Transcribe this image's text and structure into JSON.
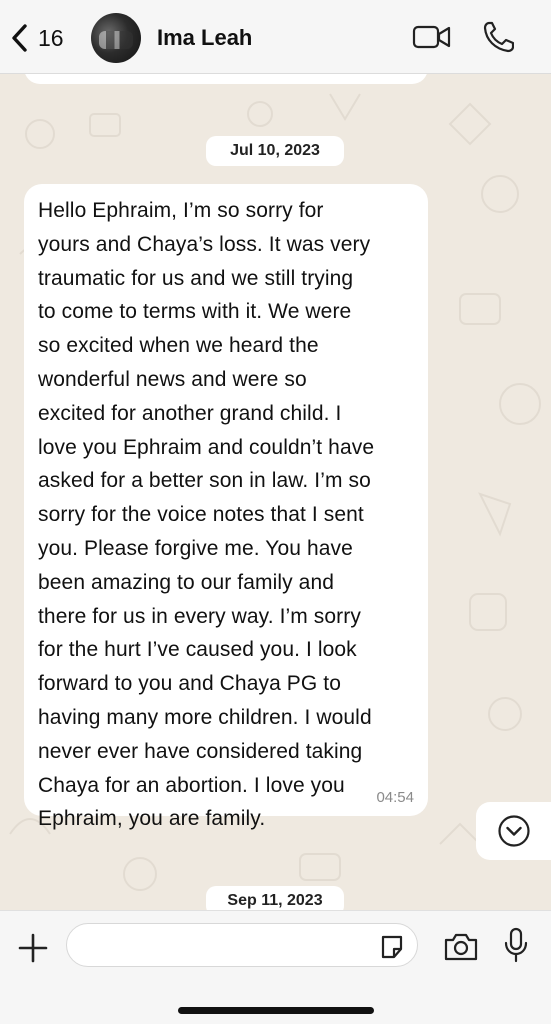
{
  "header": {
    "back_count": "16",
    "contact_name": "Ima Leah"
  },
  "chat": {
    "date_separator_1": "Jul 10, 2023",
    "message": {
      "text": "Hello Ephraim, I’m so sorry for\nyours and Chaya’s loss. It was very\ntraumatic for us and we still trying\nto come to terms with it. We were\nso excited when we heard the\nwonderful news and were so\nexcited for another grand child. I\nlove you Ephraim and couldn’t have\nasked for a better son in law. I’m so\nsorry for the voice notes that I sent\nyou. Please forgive me. You have\nbeen amazing to our family and\nthere for us in every way. I’m sorry\nfor the hurt I’ve caused you. I look\nforward to you and Chaya PG to\nhaving many more children. I would\nnever ever have considered taking\nChaya for an abortion. I love you\nEphraim, you are family.",
      "time": "04:54"
    },
    "date_separator_2": "Sep 11, 2023"
  },
  "input_bar": {
    "value": "",
    "placeholder": ""
  },
  "icons": {
    "back": "chevron-left-icon",
    "video": "video-camera-icon",
    "call": "phone-icon",
    "scroll": "chevron-down-circle-icon",
    "plus": "plus-icon",
    "sticker": "sticker-icon",
    "camera": "camera-icon",
    "mic": "microphone-icon"
  },
  "colors": {
    "background": "#efe9e0",
    "bubble": "#ffffff",
    "header": "#f6f6f6",
    "timestamp": "#8a8a8a"
  }
}
